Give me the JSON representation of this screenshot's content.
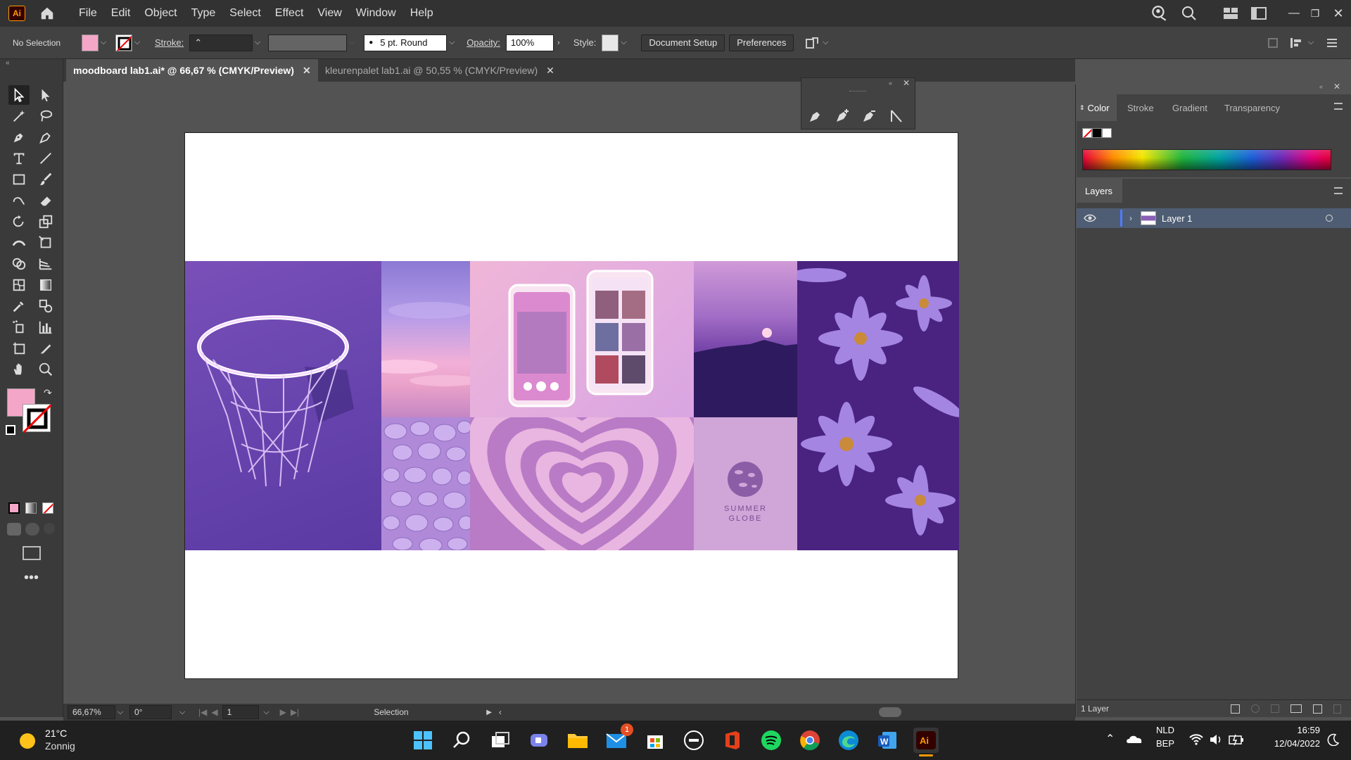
{
  "app": {
    "logo": "Ai"
  },
  "menu": [
    "File",
    "Edit",
    "Object",
    "Type",
    "Select",
    "Effect",
    "View",
    "Window",
    "Help"
  ],
  "control": {
    "selection": "No Selection",
    "fill_color": "#f4a6c8",
    "stroke_label": "Stroke:",
    "brush": "5 pt. Round",
    "opacity_label": "Opacity:",
    "opacity_value": "100%",
    "style_label": "Style:",
    "document_setup": "Document Setup",
    "preferences": "Preferences"
  },
  "tabs": [
    {
      "label": "moodboard lab1.ai* @ 66,67 % (CMYK/Preview)",
      "active": true
    },
    {
      "label": "kleurenpalet lab1.ai @ 50,55 % (CMYK/Preview)",
      "active": false
    }
  ],
  "color_panel": {
    "tabs": [
      "Color",
      "Stroke",
      "Gradient",
      "Transparency"
    ]
  },
  "layers_panel": {
    "title": "Layers",
    "layers": [
      {
        "name": "Layer 1"
      }
    ],
    "count": "1 Layer"
  },
  "status": {
    "zoom": "66,67%",
    "rotation": "0°",
    "artboard": "1",
    "tool": "Selection"
  },
  "moodboard": {
    "logo_text_line1": "SUMMER",
    "logo_text_line2": "GLOBE"
  },
  "taskbar": {
    "weather_temp": "21°C",
    "weather_desc": "Zonnig",
    "language": "NLD",
    "keyboard": "BEP",
    "time": "16:59",
    "date": "12/04/2022",
    "mail_badge": "1"
  }
}
